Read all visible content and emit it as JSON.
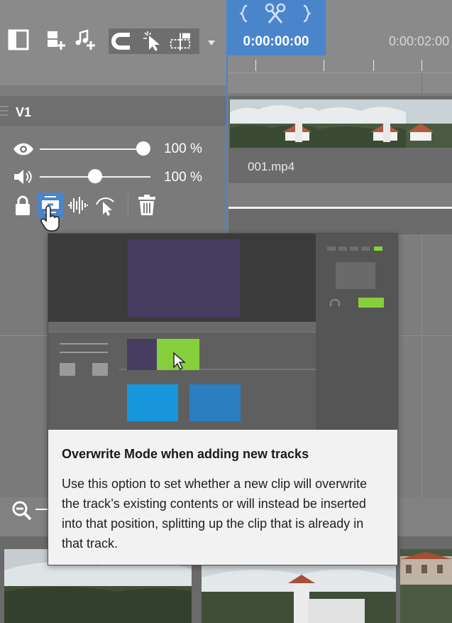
{
  "timeline": {
    "playhead_time": "0:00:00:00",
    "ruler_time": "0:00:02:00"
  },
  "track": {
    "name": "V1",
    "visibility_percent": "100 %",
    "visibility_level": 1.0,
    "volume_percent": "100 %",
    "volume_level": 0.5
  },
  "clip": {
    "name": "001.mp4"
  },
  "tooltip": {
    "title": "Overwrite Mode when adding new tracks",
    "body": "Use this option to set whether a new clip will overwrite the track’s existing contents or will instead be inserted into that position, splitting up the clip that is already in that track."
  },
  "icons": {
    "toolbar": [
      "panel-icon",
      "add-video-track-icon",
      "add-audio-track-icon",
      "magnet-icon",
      "selection-cursor-icon",
      "trim-icon",
      "dropdown-arrow-icon"
    ],
    "playhead": [
      "left-brace-icon",
      "scissors-icon",
      "right-brace-icon"
    ],
    "track": [
      "drag-handle-icon",
      "eye-icon",
      "speaker-icon",
      "lock-icon",
      "overwrite-mode-icon",
      "audio-wave-icon",
      "curve-cursor-icon",
      "trash-icon"
    ],
    "bottom": [
      "zoom-out-icon"
    ]
  },
  "colors": {
    "accent_blue": "#4a85cc",
    "preview_green": "#86cf3b",
    "preview_purple": "#463d60",
    "preview_blue": "#1796db"
  }
}
